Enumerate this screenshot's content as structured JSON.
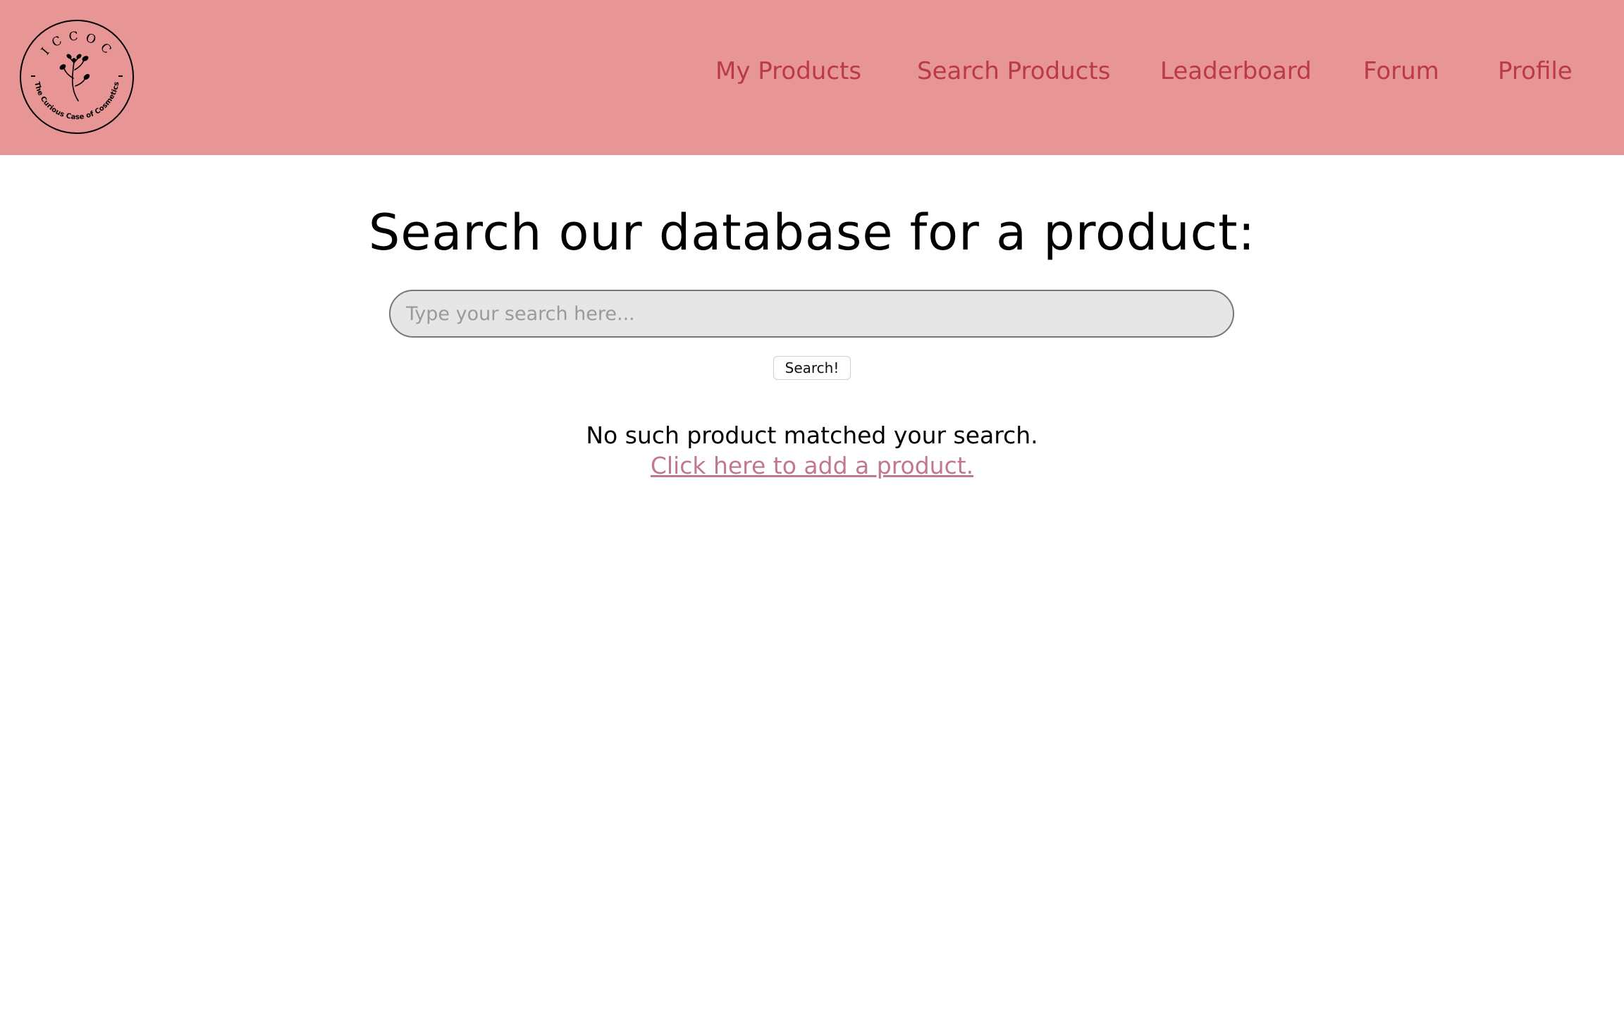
{
  "header": {
    "logo": {
      "icon": "botanical-sprig-icon",
      "letters": "I C C O C",
      "tagline": "The Curious Case of Cosmetics"
    },
    "nav": [
      {
        "label": "My Products"
      },
      {
        "label": "Search Products"
      },
      {
        "label": "Leaderboard"
      },
      {
        "label": "Forum"
      },
      {
        "label": "Profile"
      }
    ]
  },
  "main": {
    "title": "Search our database for a product:",
    "search": {
      "placeholder": "Type your search here...",
      "value": "",
      "button_label": "Search!"
    },
    "result_message": "No such product matched your search.",
    "add_product_link": "Click here to add a product."
  },
  "colors": {
    "header_bg": "#e89596",
    "nav_text": "#b83a4b",
    "link": "#c07890",
    "search_bg": "#e6e6e6"
  }
}
